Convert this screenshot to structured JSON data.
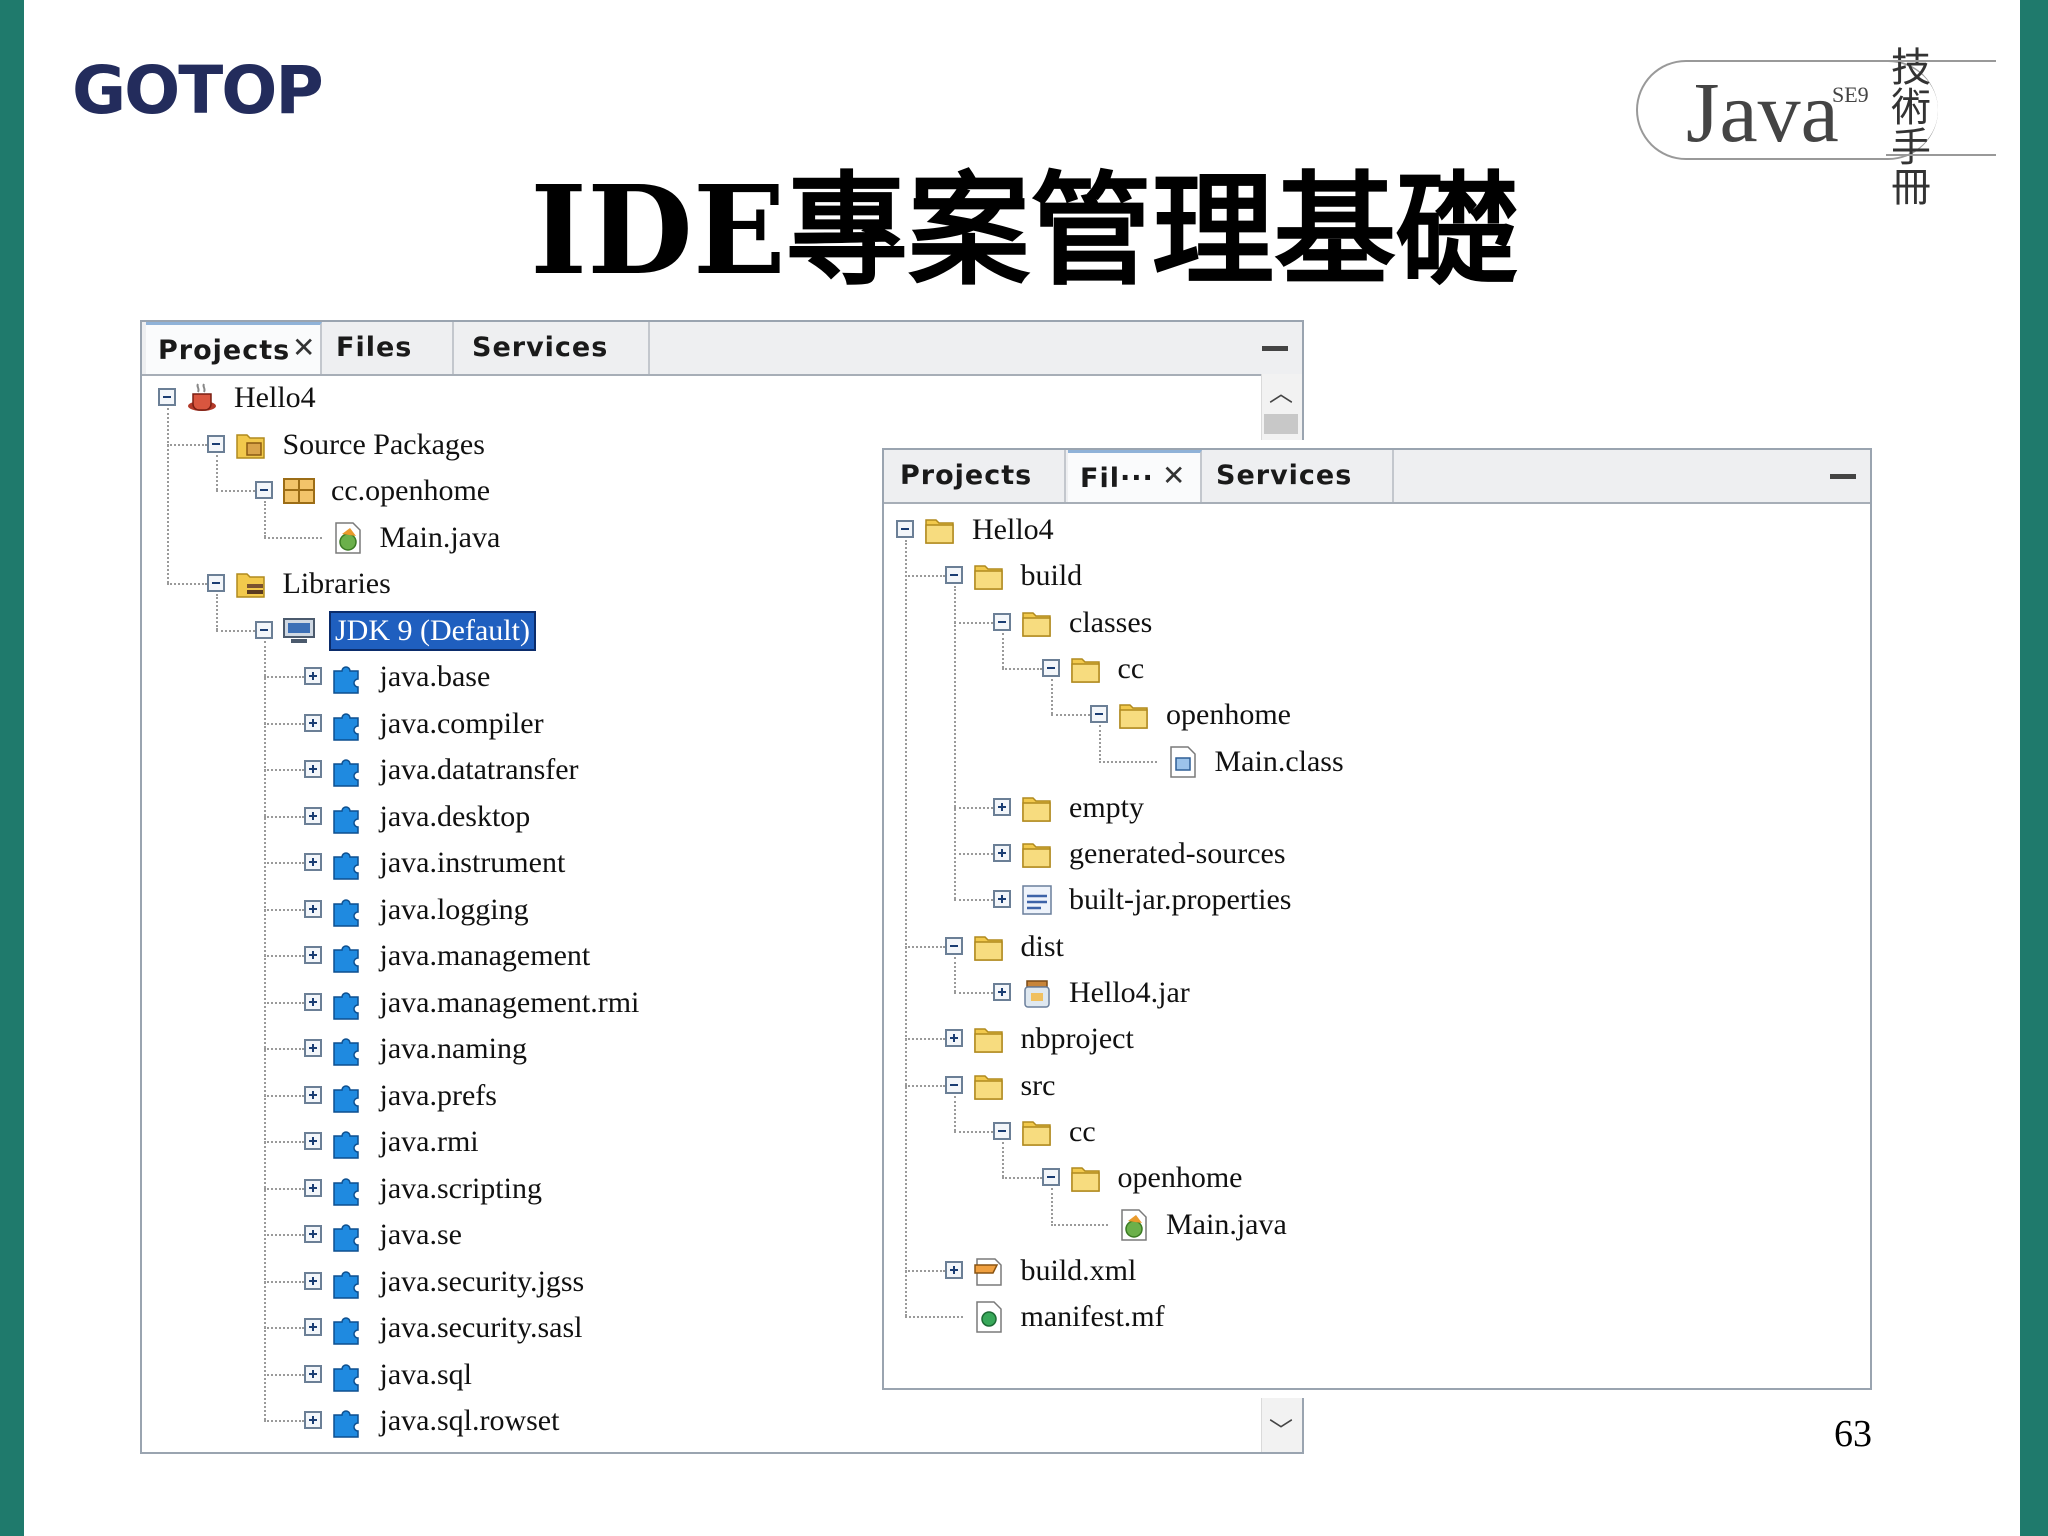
{
  "slide": {
    "brand": "GOTOP",
    "title": "IDE專案管理基礎",
    "badge_word": "Java",
    "badge_se": "SE9",
    "badge_hand": "技術手冊",
    "page_number": "63"
  },
  "panel_left": {
    "tabs": [
      {
        "label": "Projects",
        "active": true,
        "closable": true
      },
      {
        "label": "Files",
        "active": false,
        "closable": false
      },
      {
        "label": "Services",
        "active": false,
        "closable": false
      }
    ],
    "tree": [
      {
        "label": "Hello4",
        "icon": "coffee-project-icon",
        "toggle": "minus",
        "depth": 0
      },
      {
        "label": "Source Packages",
        "icon": "source-packages-icon",
        "toggle": "minus",
        "depth": 1
      },
      {
        "label": "cc.openhome",
        "icon": "package-icon",
        "toggle": "minus",
        "depth": 2
      },
      {
        "label": "Main.java",
        "icon": "java-file-icon",
        "toggle": "none",
        "depth": 3
      },
      {
        "label": "Libraries",
        "icon": "libraries-icon",
        "toggle": "minus",
        "depth": 1
      },
      {
        "label": "JDK 9 (Default)",
        "icon": "jdk-icon",
        "toggle": "minus",
        "depth": 2,
        "selected": true
      },
      {
        "label": "java.base",
        "icon": "module-icon",
        "toggle": "plus",
        "depth": 3
      },
      {
        "label": "java.compiler",
        "icon": "module-icon",
        "toggle": "plus",
        "depth": 3
      },
      {
        "label": "java.datatransfer",
        "icon": "module-icon",
        "toggle": "plus",
        "depth": 3
      },
      {
        "label": "java.desktop",
        "icon": "module-icon",
        "toggle": "plus",
        "depth": 3
      },
      {
        "label": "java.instrument",
        "icon": "module-icon",
        "toggle": "plus",
        "depth": 3
      },
      {
        "label": "java.logging",
        "icon": "module-icon",
        "toggle": "plus",
        "depth": 3
      },
      {
        "label": "java.management",
        "icon": "module-icon",
        "toggle": "plus",
        "depth": 3
      },
      {
        "label": "java.management.rmi",
        "icon": "module-icon",
        "toggle": "plus",
        "depth": 3
      },
      {
        "label": "java.naming",
        "icon": "module-icon",
        "toggle": "plus",
        "depth": 3
      },
      {
        "label": "java.prefs",
        "icon": "module-icon",
        "toggle": "plus",
        "depth": 3
      },
      {
        "label": "java.rmi",
        "icon": "module-icon",
        "toggle": "plus",
        "depth": 3
      },
      {
        "label": "java.scripting",
        "icon": "module-icon",
        "toggle": "plus",
        "depth": 3
      },
      {
        "label": "java.se",
        "icon": "module-icon",
        "toggle": "plus",
        "depth": 3
      },
      {
        "label": "java.security.jgss",
        "icon": "module-icon",
        "toggle": "plus",
        "depth": 3
      },
      {
        "label": "java.security.sasl",
        "icon": "module-icon",
        "toggle": "plus",
        "depth": 3
      },
      {
        "label": "java.sql",
        "icon": "module-icon",
        "toggle": "plus",
        "depth": 3
      },
      {
        "label": "java.sql.rowset",
        "icon": "module-icon",
        "toggle": "plus",
        "depth": 3
      }
    ]
  },
  "panel_right": {
    "tabs": [
      {
        "label": "Projects",
        "active": false,
        "closable": false
      },
      {
        "label": "Fil···",
        "active": true,
        "closable": true
      },
      {
        "label": "Services",
        "active": false,
        "closable": false
      }
    ],
    "tree": [
      {
        "label": "Hello4",
        "icon": "folder-icon",
        "toggle": "minus",
        "depth": 0
      },
      {
        "label": "build",
        "icon": "folder-icon",
        "toggle": "minus",
        "depth": 1
      },
      {
        "label": "classes",
        "icon": "folder-icon",
        "toggle": "minus",
        "depth": 2
      },
      {
        "label": "cc",
        "icon": "folder-icon",
        "toggle": "minus",
        "depth": 3
      },
      {
        "label": "openhome",
        "icon": "folder-icon",
        "toggle": "minus",
        "depth": 4
      },
      {
        "label": "Main.class",
        "icon": "class-file-icon",
        "toggle": "none",
        "depth": 5
      },
      {
        "label": "empty",
        "icon": "folder-icon",
        "toggle": "plus",
        "depth": 2
      },
      {
        "label": "generated-sources",
        "icon": "folder-icon",
        "toggle": "plus",
        "depth": 2
      },
      {
        "label": "built-jar.properties",
        "icon": "properties-file-icon",
        "toggle": "plus",
        "depth": 2
      },
      {
        "label": "dist",
        "icon": "folder-icon",
        "toggle": "minus",
        "depth": 1
      },
      {
        "label": "Hello4.jar",
        "icon": "jar-file-icon",
        "toggle": "plus",
        "depth": 2
      },
      {
        "label": "nbproject",
        "icon": "folder-icon",
        "toggle": "plus",
        "depth": 1
      },
      {
        "label": "src",
        "icon": "folder-icon",
        "toggle": "minus",
        "depth": 1
      },
      {
        "label": "cc",
        "icon": "folder-icon",
        "toggle": "minus",
        "depth": 2
      },
      {
        "label": "openhome",
        "icon": "folder-icon",
        "toggle": "minus",
        "depth": 3
      },
      {
        "label": "Main.java",
        "icon": "java-file-icon",
        "toggle": "none",
        "depth": 4
      },
      {
        "label": "build.xml",
        "icon": "ant-build-icon",
        "toggle": "plus",
        "depth": 1
      },
      {
        "label": "manifest.mf",
        "icon": "manifest-file-icon",
        "toggle": "none",
        "depth": 1
      }
    ]
  }
}
